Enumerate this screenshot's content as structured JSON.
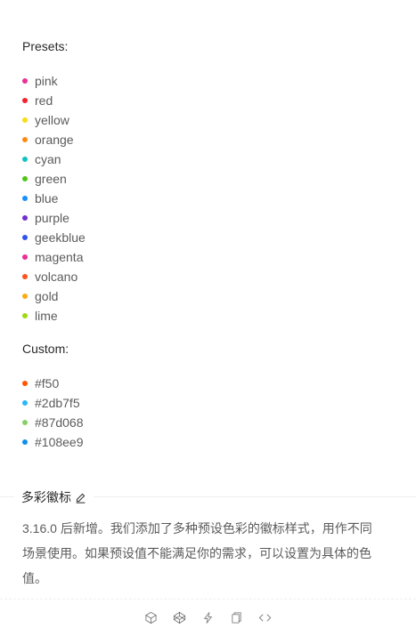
{
  "presets": {
    "title": "Presets:",
    "items": [
      {
        "label": "pink",
        "color": "#eb2f96"
      },
      {
        "label": "red",
        "color": "#f5222d"
      },
      {
        "label": "yellow",
        "color": "#fadb14"
      },
      {
        "label": "orange",
        "color": "#fa8c16"
      },
      {
        "label": "cyan",
        "color": "#13c2c2"
      },
      {
        "label": "green",
        "color": "#52c41a"
      },
      {
        "label": "blue",
        "color": "#1890ff"
      },
      {
        "label": "purple",
        "color": "#722ed1"
      },
      {
        "label": "geekblue",
        "color": "#2f54eb"
      },
      {
        "label": "magenta",
        "color": "#eb2f96"
      },
      {
        "label": "volcano",
        "color": "#fa541c"
      },
      {
        "label": "gold",
        "color": "#faad14"
      },
      {
        "label": "lime",
        "color": "#a0d911"
      }
    ]
  },
  "custom": {
    "title": "Custom:",
    "items": [
      {
        "label": "#f50",
        "color": "#ff5500"
      },
      {
        "label": "#2db7f5",
        "color": "#2db7f5"
      },
      {
        "label": "#87d068",
        "color": "#87d068"
      },
      {
        "label": "#108ee9",
        "color": "#108ee9"
      }
    ]
  },
  "meta": {
    "title": "多彩徽标",
    "edit_icon": "edit-icon",
    "description_line1": "3.16.0 后新增。我们添加了多种预设色彩的徽标样式，用作不同",
    "description_line2": "场景使用。如果预设值不能满足你的需求，可以设置为具体的色",
    "description_line3": "值。"
  },
  "actions": {
    "icons": [
      "codesandbox-icon",
      "codepen-icon",
      "thunderbolt-icon",
      "copy-icon",
      "code-expand-icon"
    ]
  }
}
